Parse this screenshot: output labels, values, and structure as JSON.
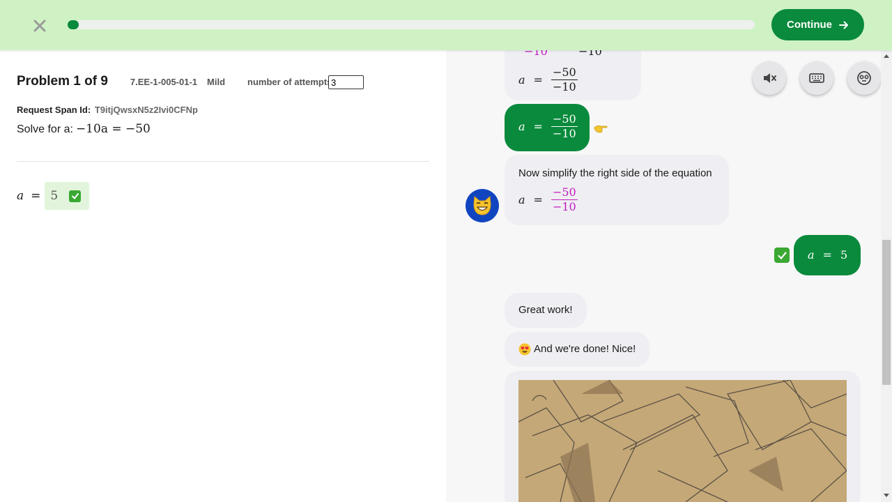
{
  "topbar": {
    "continue_label": "Continue",
    "progress_fraction": 0.015
  },
  "problem": {
    "title": "Problem 1 of 9",
    "code": "7.EE-1-005-01-1",
    "level": "Mild",
    "attempts_label": "number of attempts:",
    "attempts_value": "3",
    "span_label": "Request Span Id:",
    "span_value": "T9itjQwsxN5z2Ivi0CFNp",
    "solve_label": "Solve for a:",
    "equation": "−10a = −50",
    "answer_var": "a",
    "answer_op": "=",
    "answer_value": "5"
  },
  "chat": {
    "partial_top": {
      "left": "−10",
      "right": "−10"
    },
    "bubble1": {
      "var": "a",
      "op": "=",
      "num": "−50",
      "den": "−10"
    },
    "bubble2": {
      "var": "a",
      "op": "=",
      "num": "−50",
      "den": "−10"
    },
    "bubble3": {
      "text": "Now simplify the right side of the equation",
      "var": "a",
      "op": "=",
      "num": "−50",
      "den": "−10"
    },
    "bubble4": {
      "var": "a",
      "op": "=",
      "value": "5"
    },
    "bubble5": {
      "text": "Great work!"
    },
    "bubble6": {
      "text": "And we're done! Nice!"
    }
  },
  "icons": {
    "close": "close-icon",
    "arrow": "arrow-right-icon",
    "mute": "speaker-mute-icon",
    "keyboard": "keyboard-icon",
    "face": "robot-face-icon",
    "avatar": "grinning-cat-emoji",
    "hand": "pointing-hand-emoji",
    "heart_eyes": "heart-eyes-emoji",
    "check": "check-mark-icon"
  },
  "colors": {
    "brand_green": "#0a8a3c",
    "topbar_bg": "#cff2c4",
    "magenta": "#c21cc2",
    "avatar_blue": "#1145c0"
  }
}
